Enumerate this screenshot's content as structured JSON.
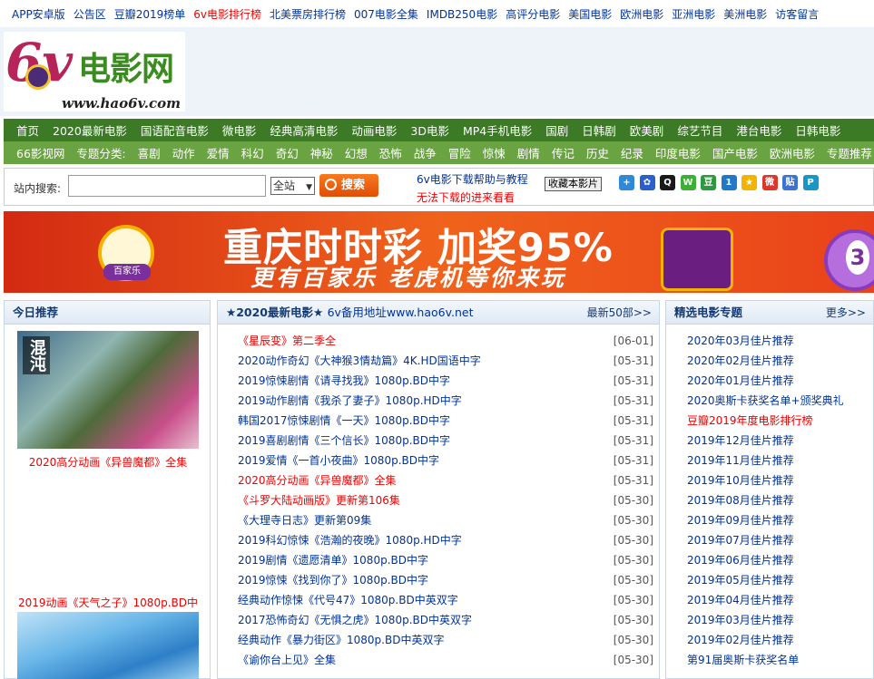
{
  "top_links": [
    {
      "label": "APP安卓版",
      "hot": false
    },
    {
      "label": "公告区",
      "hot": false
    },
    {
      "label": "豆瓣2019榜单",
      "hot": false
    },
    {
      "label": "6v电影排行榜",
      "hot": true
    },
    {
      "label": "北美票房排行榜",
      "hot": false
    },
    {
      "label": "007电影全集",
      "hot": false
    },
    {
      "label": "IMDB250电影",
      "hot": false
    },
    {
      "label": "高评分电影",
      "hot": false
    },
    {
      "label": "美国电影",
      "hot": false
    },
    {
      "label": "欧洲电影",
      "hot": false
    },
    {
      "label": "亚洲电影",
      "hot": false
    },
    {
      "label": "美洲电影",
      "hot": false
    },
    {
      "label": "访客留言",
      "hot": false
    }
  ],
  "logo": {
    "big": "6v",
    "cn": "电影网",
    "url": "www.hao6v.com"
  },
  "nav_main": [
    "首页",
    "2020最新电影",
    "国语配音电影",
    "微电影",
    "经典高清电影",
    "动画电影",
    "3D电影",
    "MP4手机电影",
    "国剧",
    "日韩剧",
    "欧美剧",
    "综艺节目",
    "港台电影",
    "日韩电影"
  ],
  "nav_sub": [
    "66影视网",
    "专题分类:",
    "喜剧",
    "动作",
    "爱情",
    "科幻",
    "奇幻",
    "神秘",
    "幻想",
    "恐怖",
    "战争",
    "冒险",
    "惊悚",
    "剧情",
    "传记",
    "历史",
    "纪录",
    "印度电影",
    "国产电影",
    "欧洲电影",
    "专题推荐"
  ],
  "search": {
    "label": "站内搜索:",
    "value": "",
    "select": "全站",
    "button": "搜索",
    "help1": "6v电影下载帮助与教程",
    "help2": "无法下载的进来看看",
    "fav": "收藏本影片"
  },
  "share_icons": [
    {
      "name": "plus-share-icon",
      "color": "#2e8ad8",
      "glyph": "+"
    },
    {
      "name": "baidu-icon",
      "color": "#2a60cc",
      "glyph": "✿"
    },
    {
      "name": "qq-icon",
      "color": "#1a1a1a",
      "glyph": "Q"
    },
    {
      "name": "wechat-icon",
      "color": "#3cb034",
      "glyph": "W"
    },
    {
      "name": "douban-icon",
      "color": "#2c9a3e",
      "glyph": "豆"
    },
    {
      "name": "renren-icon",
      "color": "#1f78c8",
      "glyph": "1"
    },
    {
      "name": "qzone-icon",
      "color": "#f1b400",
      "glyph": "★"
    },
    {
      "name": "weibo-icon",
      "color": "#e0332a",
      "glyph": "微"
    },
    {
      "name": "tieba-icon",
      "color": "#3a72d6",
      "glyph": "贴"
    },
    {
      "name": "pinterest-icon",
      "color": "#1996c8",
      "glyph": "P"
    }
  ],
  "banner": {
    "line1": "重庆时时彩 加奖95%",
    "line2": "更有百家乐 老虎机等你来玩",
    "badge": "百家乐",
    "ball": "3"
  },
  "left_box": {
    "title": "今日推荐",
    "poster1_title": "混沌",
    "cap1": "2020高分动画《异兽魔都》全集",
    "cap2": "2019动画《天气之子》1080p.BD中"
  },
  "mid_box": {
    "title": "★2020最新电影★",
    "addr": "6v备用地址www.hao6v.net",
    "more": "最新50部>>"
  },
  "movies": [
    {
      "title": "《星辰变》第二季全",
      "date": "[06-01]",
      "red": true
    },
    {
      "title": "2020动作奇幻《大神猴3情劫篇》4K.HD国语中字",
      "date": "[05-31]",
      "red": false
    },
    {
      "title": "2019惊悚剧情《请寻找我》1080p.BD中字",
      "date": "[05-31]",
      "red": false
    },
    {
      "title": "2019动作剧情《我杀了妻子》1080p.HD中字",
      "date": "[05-31]",
      "red": false
    },
    {
      "title": "韩国2017惊悚剧情《一天》1080p.BD中字",
      "date": "[05-31]",
      "red": false
    },
    {
      "title": "2019喜剧剧情《三个信长》1080p.BD中字",
      "date": "[05-31]",
      "red": false
    },
    {
      "title": "2019爱情《一首小夜曲》1080p.BD中字",
      "date": "[05-31]",
      "red": false
    },
    {
      "title": "2020高分动画《异兽魔都》全集",
      "date": "[05-31]",
      "red": true
    },
    {
      "title": "《斗罗大陆动画版》更新第106集",
      "date": "[05-30]",
      "red": true
    },
    {
      "title": "《大理寺日志》更新第09集",
      "date": "[05-30]",
      "red": false
    },
    {
      "title": "2019科幻惊悚《浩瀚的夜晚》1080p.HD中字",
      "date": "[05-30]",
      "red": false
    },
    {
      "title": "2019剧情《遗愿清单》1080p.BD中字",
      "date": "[05-30]",
      "red": false
    },
    {
      "title": "2019惊悚《找到你了》1080p.BD中字",
      "date": "[05-30]",
      "red": false
    },
    {
      "title": "经典动作惊悚《代号47》1080p.BD中英双字",
      "date": "[05-30]",
      "red": false
    },
    {
      "title": "2017恐怖奇幻《无惧之虎》1080p.BD中英双字",
      "date": "[05-30]",
      "red": false
    },
    {
      "title": "经典动作《暴力街区》1080p.BD中英双字",
      "date": "[05-30]",
      "red": false
    },
    {
      "title": "《谕你台上见》全集",
      "date": "[05-30]",
      "red": false
    }
  ],
  "right_box": {
    "title": "精选电影专题",
    "more": "更多>>"
  },
  "topics": [
    {
      "label": "2020年03月佳片推荐",
      "red": false
    },
    {
      "label": "2020年02月佳片推荐",
      "red": false
    },
    {
      "label": "2020年01月佳片推荐",
      "red": false
    },
    {
      "label": "2020奥斯卡获奖名单+颁奖典礼",
      "red": false
    },
    {
      "label": "豆瓣2019年度电影排行榜",
      "red": true
    },
    {
      "label": "2019年12月佳片推荐",
      "red": false
    },
    {
      "label": "2019年11月佳片推荐",
      "red": false
    },
    {
      "label": "2019年10月佳片推荐",
      "red": false
    },
    {
      "label": "2019年08月佳片推荐",
      "red": false
    },
    {
      "label": "2019年09月佳片推荐",
      "red": false
    },
    {
      "label": "2019年07月佳片推荐",
      "red": false
    },
    {
      "label": "2019年06月佳片推荐",
      "red": false
    },
    {
      "label": "2019年05月佳片推荐",
      "red": false
    },
    {
      "label": "2019年04月佳片推荐",
      "red": false
    },
    {
      "label": "2019年03月佳片推荐",
      "red": false
    },
    {
      "label": "2019年02月佳片推荐",
      "red": false
    },
    {
      "label": "第91届奥斯卡获奖名单",
      "red": false
    }
  ]
}
